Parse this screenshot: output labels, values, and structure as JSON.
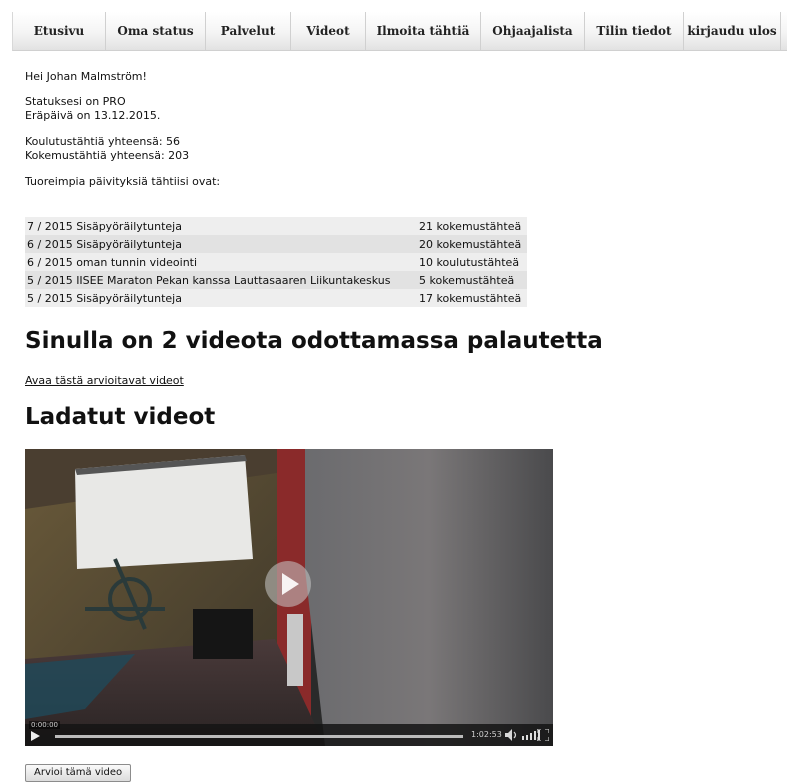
{
  "nav": {
    "items": [
      {
        "label": "Etusivu"
      },
      {
        "label": "Oma status"
      },
      {
        "label": "Palvelut"
      },
      {
        "label": "Videot"
      },
      {
        "label": "Ilmoita tähtiä"
      },
      {
        "label": "Ohjaajalista"
      },
      {
        "label": "Tilin tiedot"
      },
      {
        "label": "kirjaudu ulos"
      }
    ]
  },
  "greeting": "Hei Johan Malmström!",
  "status": {
    "line1": "Statuksesi on PRO",
    "line2": "Eräpäivä on 13.12.2015."
  },
  "stars": {
    "training": "Koulutustähtiä yhteensä: 56",
    "experience": "Kokemustähtiä yhteensä: 203"
  },
  "updates": {
    "intro": "Tuoreimpia päivityksiä tähtiisi ovat:",
    "rows": [
      {
        "activity": "7 / 2015 Sisäpyöräilytunteja",
        "stars": "21 kokemustähteä"
      },
      {
        "activity": "6 / 2015 Sisäpyöräilytunteja",
        "stars": "20 kokemustähteä"
      },
      {
        "activity": "6 / 2015 oman tunnin videointi",
        "stars": "10 koulutustähteä"
      },
      {
        "activity": "5 / 2015 IISEE Maraton Pekan kanssa Lauttasaaren Liikuntakeskus",
        "stars": "5  kokemustähteä"
      },
      {
        "activity": "5 / 2015 Sisäpyöräilytunteja",
        "stars": "17 kokemustähteä"
      }
    ]
  },
  "pending": {
    "heading": "Sinulla on 2 videota odottamassa palautetta",
    "link": "Avaa tästä arvioitavat videot",
    "link_suffix": "."
  },
  "uploaded": {
    "heading": "Ladatut videot",
    "video": {
      "time_current": "0:00:00",
      "time_total": "1:02:53",
      "play_icon": "play-icon",
      "volume_icon": "volume-icon",
      "fullscreen_icon": "fullscreen-icon"
    },
    "rate_button": "Arvioi tämä video"
  }
}
